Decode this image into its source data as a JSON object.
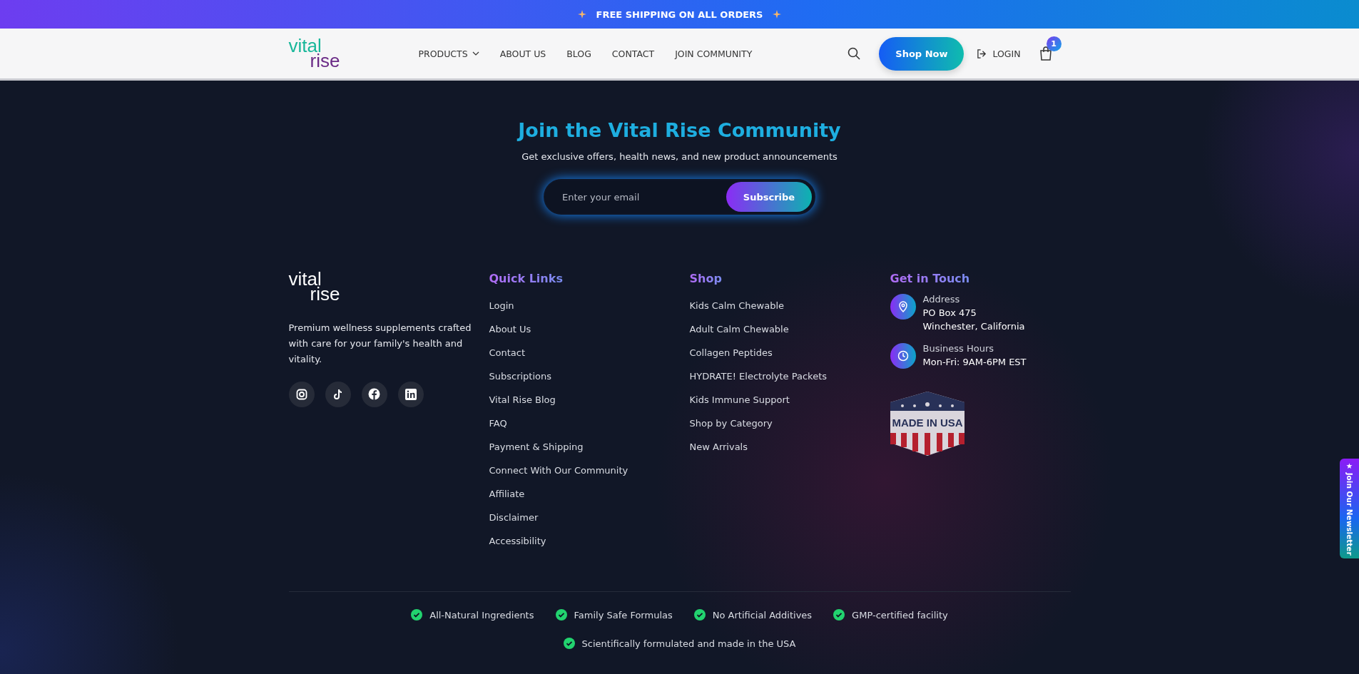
{
  "announcement": {
    "text": "FREE SHIPPING ON ALL ORDERS"
  },
  "header": {
    "logo": {
      "top": "vital",
      "bottom": "rise"
    },
    "nav": [
      {
        "label": "PRODUCTS",
        "dropdown": true
      },
      {
        "label": "ABOUT US",
        "dropdown": false
      },
      {
        "label": "BLOG",
        "dropdown": false
      },
      {
        "label": "CONTACT",
        "dropdown": false
      },
      {
        "label": "JOIN COMMUNITY",
        "dropdown": false
      }
    ],
    "shop_button": "Shop Now",
    "login": "LOGIN",
    "cart_count": "1"
  },
  "newsletter": {
    "title": "Join the Vital Rise Community",
    "subtitle": "Get exclusive offers, health news, and new product announcements",
    "email": {
      "placeholder": "Enter your email"
    },
    "button": "Subscribe"
  },
  "footer": {
    "about": {
      "logo": {
        "top": "vital",
        "bottom": "rise"
      },
      "text": "Premium wellness supplements crafted with care for your family's health and vitality.",
      "social": [
        {
          "kind": "instagram"
        },
        {
          "kind": "tiktok"
        },
        {
          "kind": "facebook"
        },
        {
          "kind": "linkedin"
        }
      ]
    },
    "quick_links": {
      "title": "Quick Links",
      "items": [
        "Login",
        "About Us",
        "Contact",
        "Subscriptions",
        "Vital Rise Blog",
        "FAQ",
        "Payment & Shipping",
        "Connect With Our Community",
        "Affiliate",
        "Disclaimer",
        "Accessibility"
      ]
    },
    "shop": {
      "title": "Shop",
      "items": [
        "Kids Calm Chewable",
        "Adult Calm Chewable",
        "Collagen Peptides",
        "HYDRATE! Electrolyte Packets",
        "Kids Immune Support",
        "Shop by Category",
        "New Arrivals"
      ]
    },
    "contact": {
      "title": "Get in Touch",
      "entries": [
        {
          "kind": "address",
          "label": "Address",
          "lines": [
            "PO Box 475",
            "Winchester, California"
          ]
        },
        {
          "kind": "hours",
          "label": "Business Hours",
          "lines": [
            "Mon-Fri: 9AM-6PM EST"
          ]
        }
      ],
      "badge": "MADE IN USA"
    },
    "features": [
      "All-Natural Ingredients",
      "Family Safe Formulas",
      "No Artificial Additives",
      "GMP-certified facility",
      "Scientifically formulated and made in the USA"
    ]
  },
  "side_tab": {
    "icon": "★",
    "label": "Join Our Newsletter"
  }
}
